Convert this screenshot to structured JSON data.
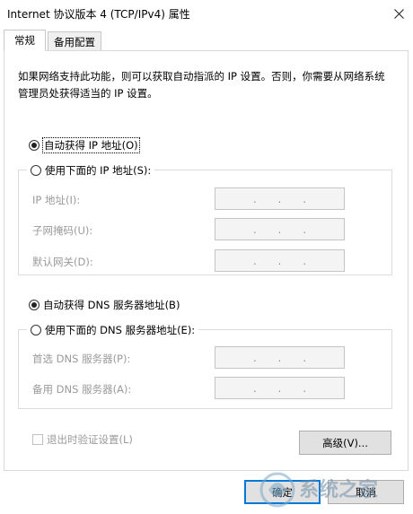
{
  "window": {
    "title": "Internet 协议版本 4 (TCP/IPv4) 属性",
    "close_icon": "close-icon"
  },
  "tabs": [
    {
      "label": "常规",
      "active": true
    },
    {
      "label": "备用配置",
      "active": false
    }
  ],
  "description": "如果网络支持此功能，则可以获取自动指派的 IP 设置。否则，你需要从网络系统管理员处获得适当的 IP 设置。",
  "ip": {
    "auto_label": "自动获得 IP 地址(O)",
    "manual_label": "使用下面的 IP 地址(S):",
    "auto_selected": true,
    "fields": [
      {
        "label": "IP 地址(I):",
        "value": ".    .    ."
      },
      {
        "label": "子网掩码(U):",
        "value": ".    .    ."
      },
      {
        "label": "默认网关(D):",
        "value": ".    .    ."
      }
    ]
  },
  "dns": {
    "auto_label": "自动获得 DNS 服务器地址(B)",
    "manual_label": "使用下面的 DNS 服务器地址(E):",
    "auto_selected": true,
    "fields": [
      {
        "label": "首选 DNS 服务器(P):",
        "value": ".    .    ."
      },
      {
        "label": "备用 DNS 服务器(A):",
        "value": ".    .    ."
      }
    ]
  },
  "validate_label": "退出时验证设置(L)",
  "advanced_label": "高级(V)...",
  "ok_label": "确定",
  "cancel_label": "取消",
  "watermark_text": "系统之家",
  "colors": {
    "accent": "#0078d7",
    "disabled_text": "#9a9a9a"
  }
}
